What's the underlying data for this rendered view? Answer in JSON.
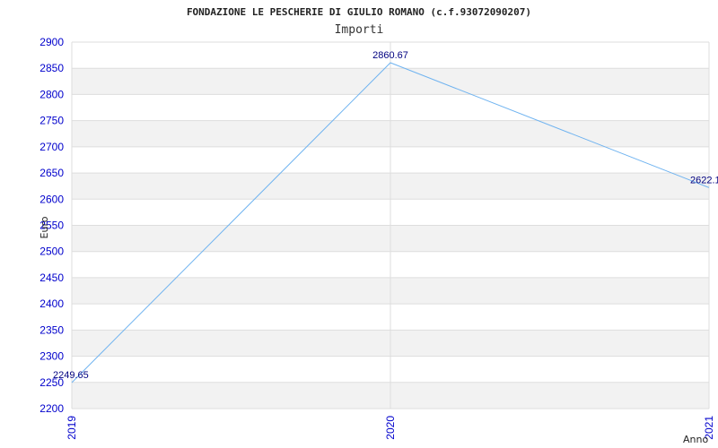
{
  "chart_data": {
    "type": "line",
    "title": "FONDAZIONE LE PESCHERIE DI GIULIO ROMANO (c.f.93072090207)",
    "subtitle": "Importi",
    "xlabel": "Anno",
    "ylabel": "Euro",
    "categories": [
      "2019",
      "2020",
      "2021"
    ],
    "series": [
      {
        "values": [
          2249.65,
          2860.67,
          2622.1
        ]
      }
    ],
    "data_labels": [
      "2249.65",
      "2860.67",
      "2622.1"
    ],
    "yticks": [
      2200,
      2250,
      2300,
      2350,
      2400,
      2450,
      2500,
      2550,
      2600,
      2650,
      2700,
      2750,
      2800,
      2850,
      2900
    ],
    "ylim": [
      2200,
      2900
    ],
    "grid": true,
    "line_color": "#6fb3f0",
    "band_color": "#f2f2f2",
    "tick_color": "#0000cc"
  }
}
